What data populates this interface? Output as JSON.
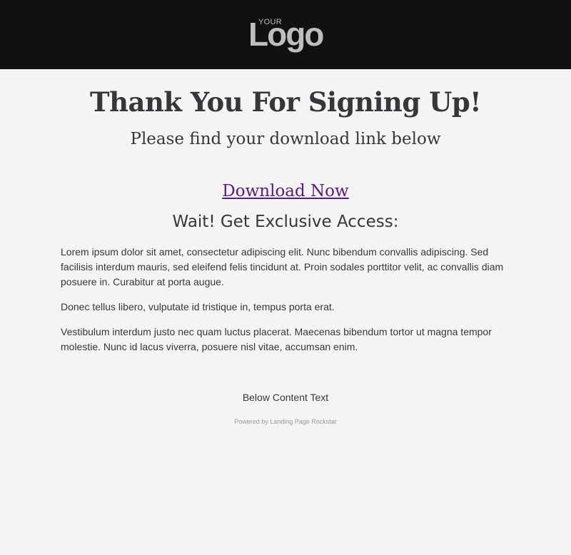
{
  "header": {
    "logo_small": "YOUR",
    "logo_word": "Logo"
  },
  "main": {
    "title": "Thank You For Signing Up!",
    "subtitle": "Please find your download link below",
    "download_label": "Download Now",
    "offer_heading": "Wait! Get Exclusive Access:",
    "paragraphs": [
      "Lorem ipsum dolor sit amet, consectetur adipiscing elit. Nunc bibendum convallis adipiscing. Sed facilisis interdum mauris, sed eleifend felis tincidunt at. Proin sodales porttitor velit, ac convallis diam posuere in. Curabitur at porta augue.",
      "Donec tellus libero, vulputate id tristique in, tempus porta erat.",
      "Vestibulum interdum justo nec quam luctus placerat. Maecenas bibendum tortor ut magna tempor molestie. Nunc id lacus viverra, posuere nisl vitae, accumsan enim."
    ],
    "below_content": "Below Content Text",
    "powered_by": "Powered by Landing Page Rockstar"
  },
  "colors": {
    "header_bg": "#111111",
    "page_bg": "#f4f4f4",
    "text": "#35373a",
    "link": "#5a1a8c",
    "logo": "#bdbdbd"
  }
}
